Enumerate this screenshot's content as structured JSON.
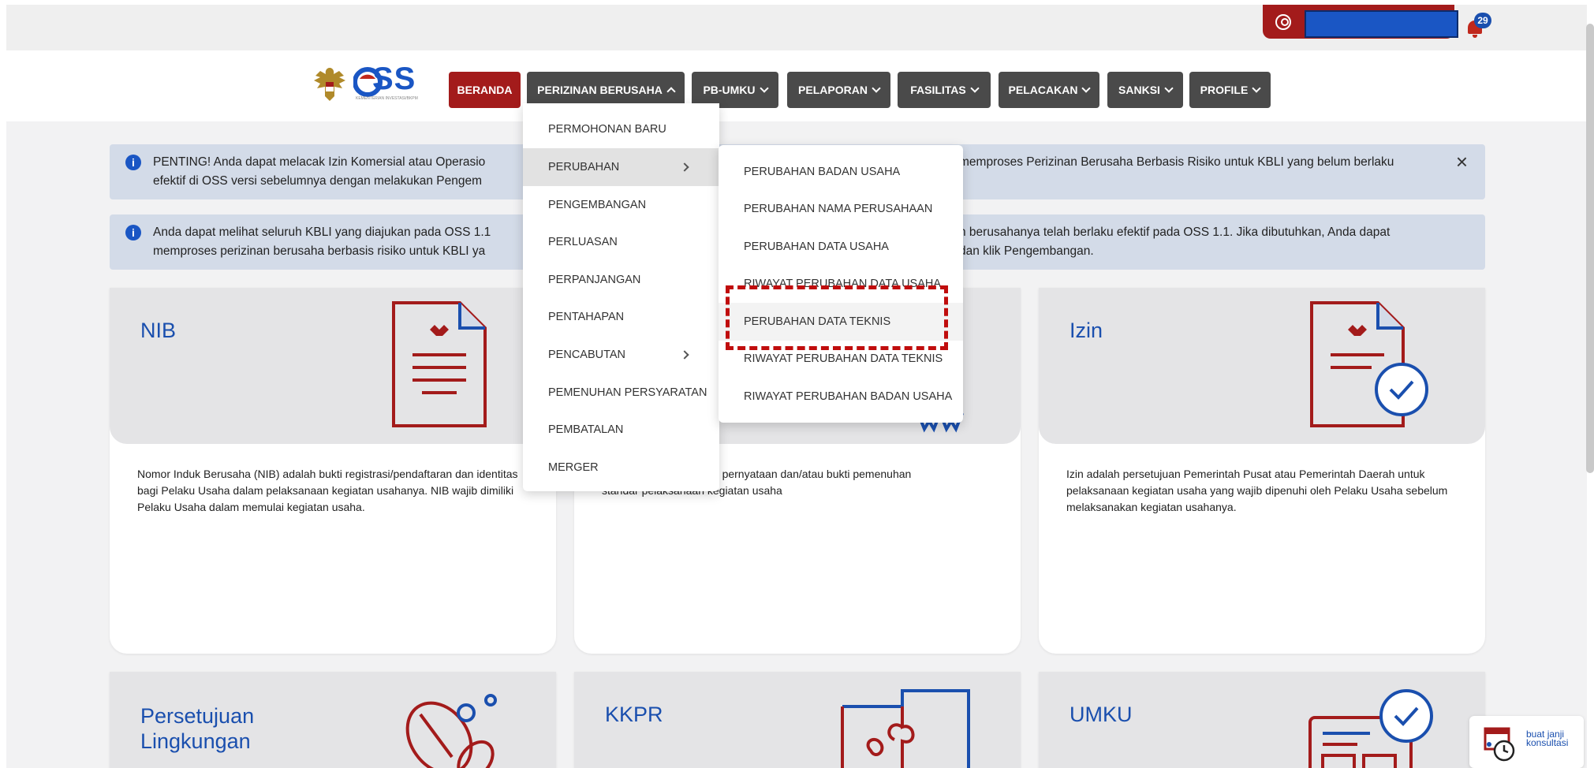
{
  "topbar": {
    "notification_count": "29"
  },
  "navbar": {
    "logo_text": "OSS",
    "logo_subtext": "KEMENTERIAN INVESTASI/BKPM",
    "items": [
      {
        "label": "BERANDA"
      },
      {
        "label": "PERIZINAN BERUSAHA"
      },
      {
        "label": "PB-UMKU"
      },
      {
        "label": "PELAPORAN"
      },
      {
        "label": "FASILITAS"
      },
      {
        "label": "PELACAKAN"
      },
      {
        "label": "SANKSI"
      },
      {
        "label": "PROFILE"
      }
    ]
  },
  "alerts": [
    {
      "line1_left": "PENTING! Anda dapat melacak Izin Komersial atau Operasio",
      "line1_right": "memproses Perizinan Berusaha Berbasis Risiko untuk KBLI yang belum berlaku",
      "line2_left": "efektif di OSS versi sebelumnya dengan melakukan Pengem"
    },
    {
      "line1_left": "Anda dapat melihat seluruh KBLI yang diajukan pada OSS 1.1",
      "line1_right": "n berusahanya telah berlaku efektif pada OSS 1.1. Jika dibutuhkan, Anda dapat",
      "line2_left": "memproses perizinan berusaha berbasis risiko untuk KBLI ya",
      "line2_right": "dan klik Pengembangan."
    }
  ],
  "cards": [
    {
      "title": "NIB",
      "desc": "Nomor Induk Berusaha (NIB) adalah bukti registrasi/pendaftaran dan identitas bagi Pelaku Usaha dalam pelaksanaan kegiatan usahanya. NIB wajib dimiliki Pelaku Usaha dalam memulai kegiatan usaha."
    },
    {
      "title": "",
      "desc_line1": "lah pernyataan dan/atau bukti pemenuhan",
      "desc_line2": "standar pelaksanaan kegiatan usaha"
    },
    {
      "title": "Izin",
      "desc": "Izin adalah persetujuan Pemerintah Pusat atau Pemerintah Daerah untuk pelaksanaan kegiatan usaha yang wajib dipenuhi oleh Pelaku Usaha sebelum melaksanakan kegiatan usahanya."
    },
    {
      "title": "Persetujuan Lingkungan"
    },
    {
      "title": "KKPR"
    },
    {
      "title": "UMKU"
    }
  ],
  "dropdown": {
    "items": [
      {
        "label": "PERMOHONAN BARU"
      },
      {
        "label": "PERUBAHAN"
      },
      {
        "label": "PENGEMBANGAN"
      },
      {
        "label": "PERLUASAN"
      },
      {
        "label": "PERPANJANGAN"
      },
      {
        "label": "PENTAHAPAN"
      },
      {
        "label": "PENCABUTAN"
      },
      {
        "label": "PEMENUHAN PERSYARATAN"
      },
      {
        "label": "PEMBATALAN"
      },
      {
        "label": "MERGER"
      }
    ]
  },
  "submenu": {
    "items": [
      {
        "label": "PERUBAHAN BADAN USAHA"
      },
      {
        "label": "PERUBAHAN NAMA PERUSAHAAN"
      },
      {
        "label": "PERUBAHAN DATA USAHA"
      },
      {
        "label": "RIWAYAT PERUBAHAN DATA USAHA"
      },
      {
        "label": "PERUBAHAN DATA TEKNIS"
      },
      {
        "label": "RIWAYAT PERUBAHAN DATA TEKNIS"
      },
      {
        "label": "RIWAYAT PERUBAHAN BADAN USAHA"
      }
    ]
  },
  "konsultasi": {
    "label_line1": "buat janji",
    "label_line2": "konsultasi"
  },
  "colors": {
    "brand_red": "#a31b1b",
    "brand_blue": "#1a4fae",
    "nav_gray": "#4a4a4a"
  }
}
